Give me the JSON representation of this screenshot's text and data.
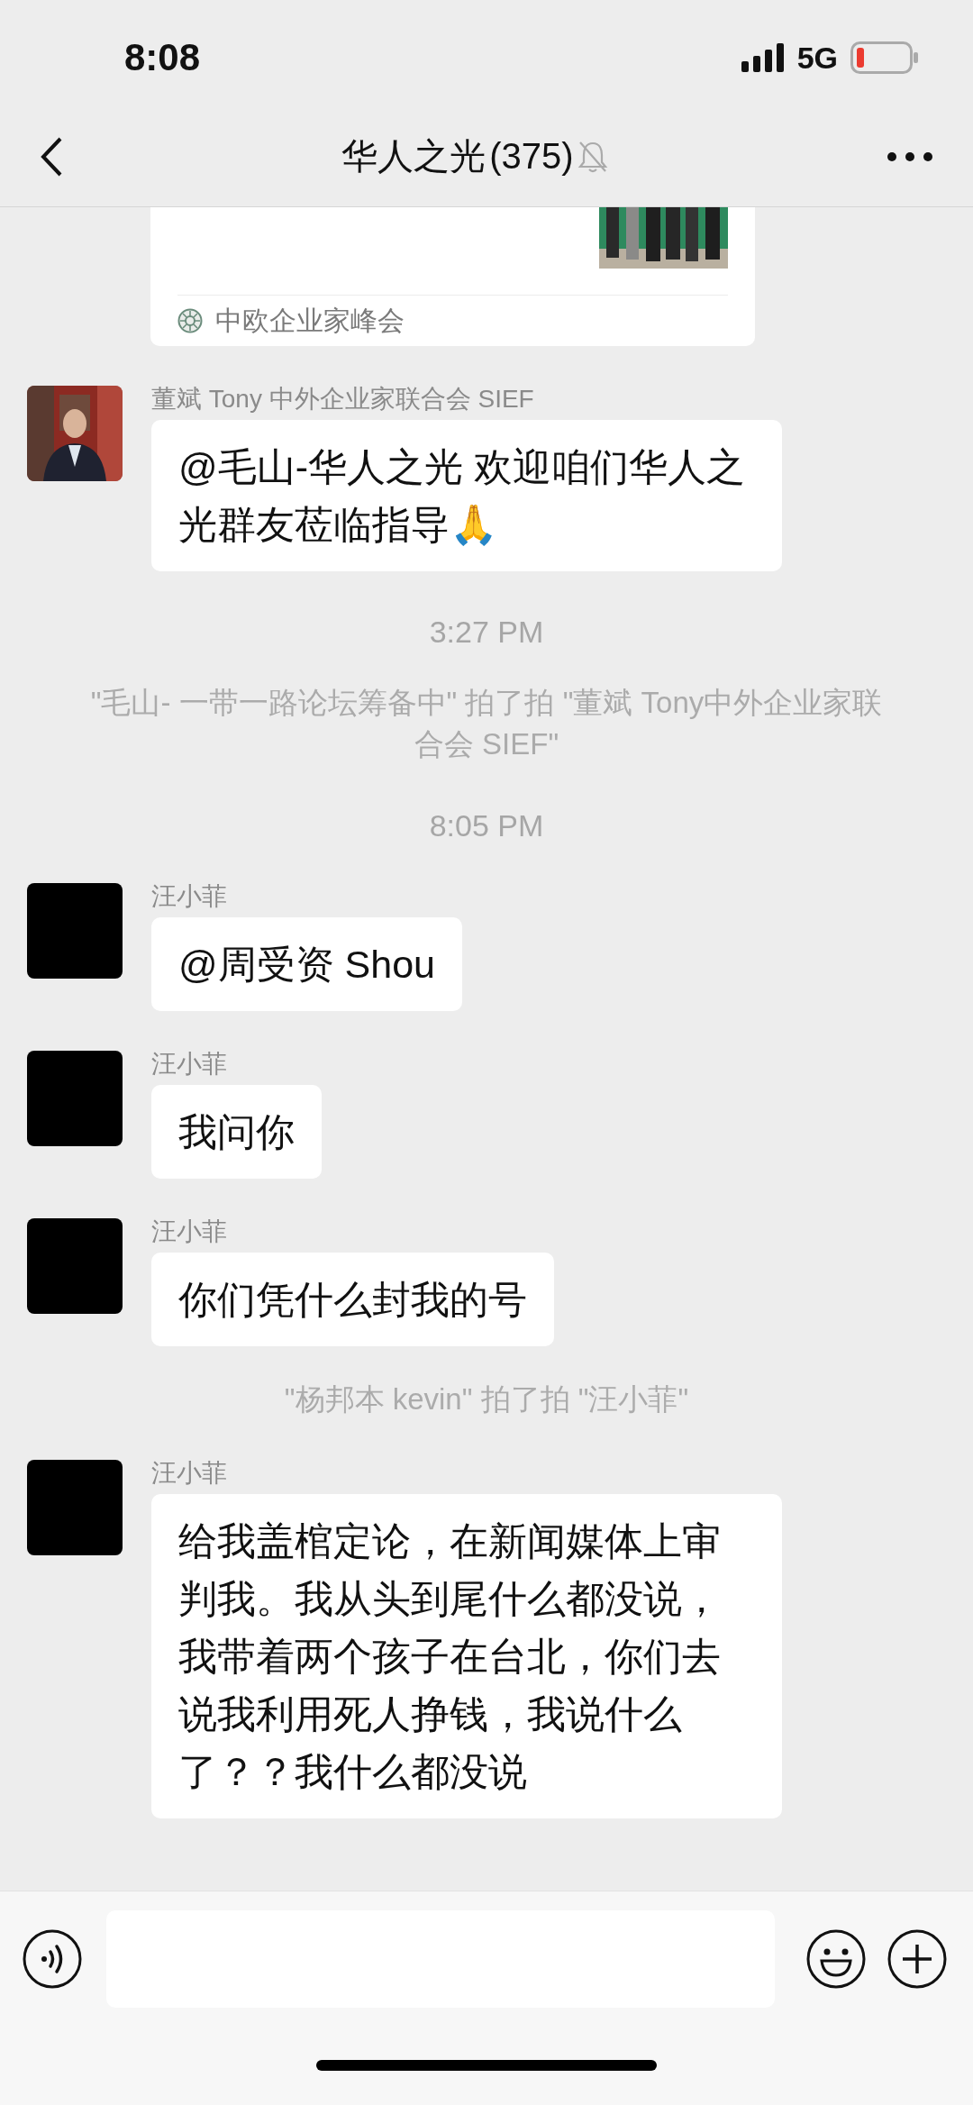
{
  "status_bar": {
    "time": "8:08",
    "network": "5G"
  },
  "nav": {
    "title": "华人之光",
    "member_count": "(375)",
    "muted": true
  },
  "messages": [
    {
      "kind": "link_card",
      "source": "中欧企业家峰会"
    },
    {
      "kind": "text",
      "sender": "董斌 Tony 中外企业家联合会 SIEF",
      "avatar_hidden": false,
      "text": "@毛山-华人之光 欢迎咱们华人之光群友莅临指导🙏"
    },
    {
      "kind": "time",
      "text": "3:27 PM"
    },
    {
      "kind": "system",
      "text": "\"毛山- 一带一路论坛筹备中\" 拍了拍 \"董斌 Tony中外企业家联合会 SIEF\""
    },
    {
      "kind": "time",
      "text": "8:05 PM"
    },
    {
      "kind": "text",
      "sender": "汪小菲",
      "avatar_hidden": true,
      "text": "@周受资 Shou"
    },
    {
      "kind": "text",
      "sender": "汪小菲",
      "avatar_hidden": true,
      "text": "我问你"
    },
    {
      "kind": "text",
      "sender": "汪小菲",
      "avatar_hidden": true,
      "text": "你们凭什么封我的号"
    },
    {
      "kind": "system",
      "text": "\"杨邦本 kevin\" 拍了拍 \"汪小菲\""
    },
    {
      "kind": "text",
      "sender": "汪小菲",
      "avatar_hidden": true,
      "text": "给我盖棺定论，在新闻媒体上审判我。我从头到尾什么都没说，我带着两个孩子在台北，你们去说我利用死人挣钱，我说什么了？？我什么都没说"
    }
  ]
}
